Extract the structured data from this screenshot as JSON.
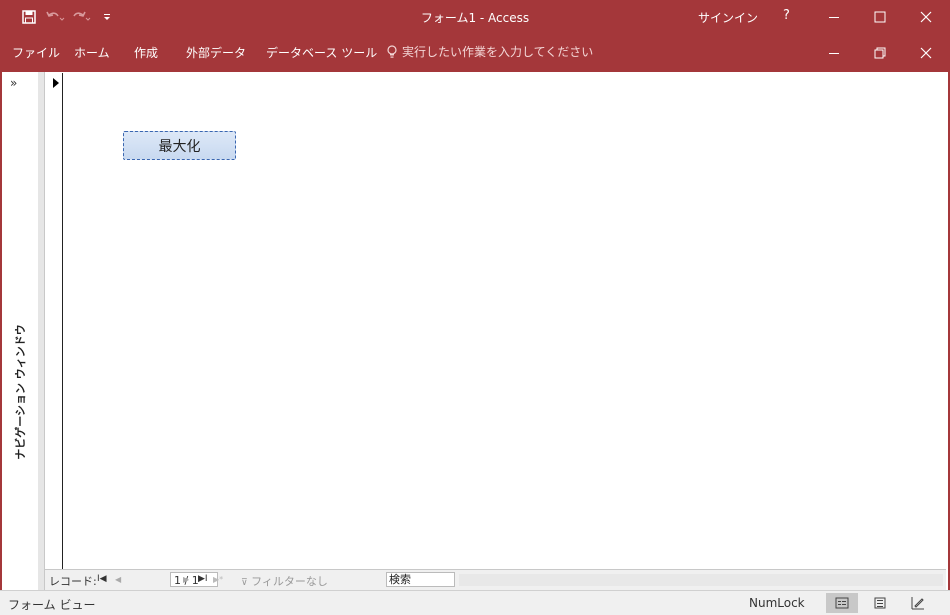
{
  "window": {
    "title": "フォーム1  -  Access",
    "signin": "サインイン",
    "help": "?"
  },
  "ribbon": {
    "tabs": [
      "ファイル",
      "ホーム",
      "作成",
      "外部データ",
      "データベース ツール"
    ],
    "tell_me": "実行したい作業を入力してください"
  },
  "nav_pane": {
    "label": "ナビゲーション ウィンドウ",
    "expand": "»"
  },
  "form": {
    "button_label": "最大化"
  },
  "record_nav": {
    "label": "レコード:",
    "first": "I◀",
    "prev": "◀",
    "position": "1 / 1",
    "next": "▶",
    "last": "▶I",
    "new": "▶*",
    "filter": "フィルターなし",
    "search": "検索"
  },
  "status": {
    "view": "フォーム ビュー",
    "numlock": "NumLock"
  },
  "colors": {
    "accent": "#a4373a",
    "button_fill": "#c8d9f0",
    "button_border": "#3a66b0"
  }
}
